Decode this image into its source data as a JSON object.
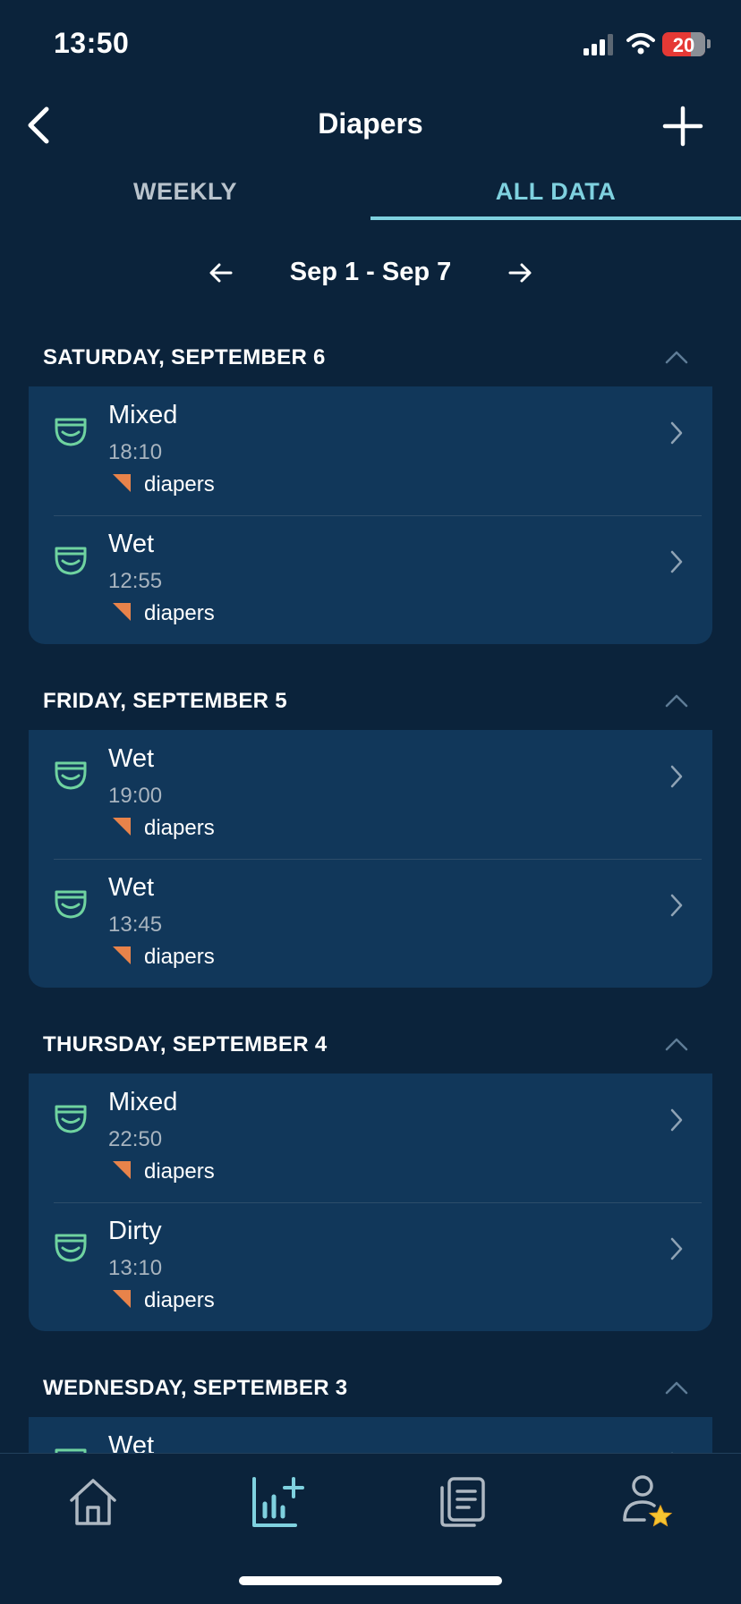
{
  "status": {
    "time": "13:50",
    "battery": "20"
  },
  "nav": {
    "title": "Diapers",
    "back_icon": "chevron-left-icon",
    "add_icon": "plus-icon"
  },
  "tabs": [
    {
      "label": "WEEKLY",
      "selected": false
    },
    {
      "label": "ALL DATA",
      "selected": true
    }
  ],
  "range": {
    "label": "Sep 1 - Sep 7"
  },
  "days": [
    {
      "title": "SATURDAY, SEPTEMBER 6",
      "entries": [
        {
          "type": "Mixed",
          "time": "18:10",
          "tag": "diapers"
        },
        {
          "type": "Wet",
          "time": "12:55",
          "tag": "diapers"
        }
      ]
    },
    {
      "title": "FRIDAY, SEPTEMBER 5",
      "entries": [
        {
          "type": "Wet",
          "time": "19:00",
          "tag": "diapers"
        },
        {
          "type": "Wet",
          "time": "13:45",
          "tag": "diapers"
        }
      ]
    },
    {
      "title": "THURSDAY, SEPTEMBER 4",
      "entries": [
        {
          "type": "Mixed",
          "time": "22:50",
          "tag": "diapers"
        },
        {
          "type": "Dirty",
          "time": "13:10",
          "tag": "diapers"
        }
      ]
    },
    {
      "title": "WEDNESDAY, SEPTEMBER 3",
      "entries": [
        {
          "type": "Wet"
        }
      ]
    }
  ],
  "tab_bar": [
    {
      "icon": "home-icon",
      "selected": false
    },
    {
      "icon": "chart-add-icon",
      "selected": true
    },
    {
      "icon": "document-list-icon",
      "selected": false
    },
    {
      "icon": "profile-star-icon",
      "selected": false
    }
  ],
  "colors": {
    "background": "#0b233b",
    "card": "#11375a",
    "accent": "#7fd1df",
    "diaper_icon": "#6fd3a0",
    "tag_flag": "#e8834a"
  }
}
